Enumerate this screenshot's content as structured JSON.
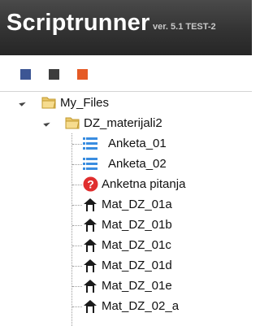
{
  "header": {
    "title": "Scriptrunner",
    "version": "ver. 5.1 TEST-2"
  },
  "toolbar": {
    "buttons": [
      {
        "name": "blue-square-button",
        "color": "#3c5694"
      },
      {
        "name": "dark-square-button",
        "color": "#3d3d3d"
      },
      {
        "name": "orange-square-button",
        "color": "#e55a25"
      }
    ]
  },
  "tree": {
    "root": {
      "label": "My_Files",
      "icon": "folder-open-icon"
    },
    "folder": {
      "label": "DZ_materijali2",
      "icon": "folder-open-icon"
    },
    "items": [
      {
        "label": "Anketa_01",
        "icon": "list-icon"
      },
      {
        "label": "Anketa_02",
        "icon": "list-icon"
      },
      {
        "label": "Anketna pitanja",
        "icon": "question-icon"
      },
      {
        "label": "Mat_DZ_01a",
        "icon": "house-icon"
      },
      {
        "label": "Mat_DZ_01b",
        "icon": "house-icon"
      },
      {
        "label": "Mat_DZ_01c",
        "icon": "house-icon"
      },
      {
        "label": "Mat_DZ_01d",
        "icon": "house-icon"
      },
      {
        "label": "Mat_DZ_01e",
        "icon": "house-icon"
      },
      {
        "label": "Mat_DZ_02_a",
        "icon": "house-icon"
      }
    ]
  }
}
